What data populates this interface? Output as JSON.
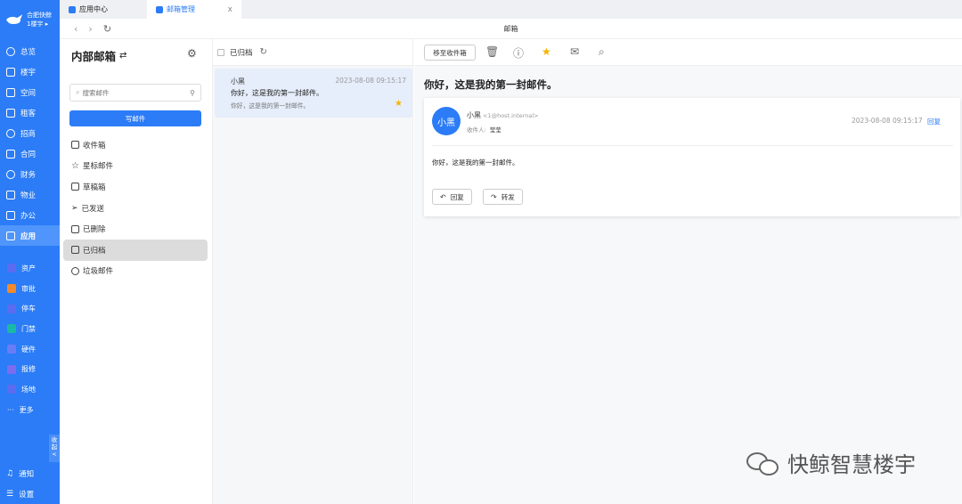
{
  "sidebar": {
    "org_line1": "合肥快鲸",
    "org_line2": "1楼宇",
    "nav": [
      {
        "label": "总览",
        "icon": "dashboard-icon"
      },
      {
        "label": "楼宇",
        "icon": "building-icon"
      },
      {
        "label": "空间",
        "icon": "space-icon"
      },
      {
        "label": "租客",
        "icon": "tenant-icon"
      },
      {
        "label": "招商",
        "icon": "investment-icon"
      },
      {
        "label": "合同",
        "icon": "contract-icon"
      },
      {
        "label": "财务",
        "icon": "finance-icon"
      },
      {
        "label": "物业",
        "icon": "property-icon"
      },
      {
        "label": "办公",
        "icon": "office-icon"
      },
      {
        "label": "应用",
        "icon": "apps-icon"
      }
    ],
    "apps": [
      {
        "label": "资产",
        "color": "#5b6cf0"
      },
      {
        "label": "审批",
        "color": "#f28a2b"
      },
      {
        "label": "停车",
        "color": "#5b6cf0"
      },
      {
        "label": "门禁",
        "color": "#19b9a6"
      },
      {
        "label": "硬件",
        "color": "#6a7cf5"
      },
      {
        "label": "报修",
        "color": "#7b6cf0"
      },
      {
        "label": "场地",
        "color": "#5b6cf0"
      }
    ],
    "more": "更多",
    "collapse": [
      "收",
      "起",
      "<"
    ],
    "notify": "通知",
    "settings": "设置"
  },
  "tabs": [
    {
      "label": "应用中心"
    },
    {
      "label": "邮箱管理",
      "close": "x"
    }
  ],
  "toolbar": {
    "title": "邮箱"
  },
  "mailbox": {
    "title": "内部邮箱",
    "search_placeholder": "搜索邮件",
    "compose": "写邮件",
    "folders": [
      "收件箱",
      "星标邮件",
      "草稿箱",
      "已发送",
      "已删除",
      "已归档",
      "垃圾邮件"
    ]
  },
  "list": {
    "header": "已归档",
    "item": {
      "sender": "小黑",
      "time": "2023-08-08 09:15:17",
      "subject": "你好，这是我的第一封邮件。",
      "preview": "你好，这是我的第一封邮件。"
    }
  },
  "reader": {
    "move_button": "移至收件箱",
    "subject": "你好，这是我的第一封邮件。",
    "avatar": "小黑",
    "from_name": "小黑",
    "from_addr": "<1@host.internal>",
    "to_label": "收件人:",
    "to_value": "莹莹",
    "time": "2023-08-08 09:15:17",
    "reply_link": "回复",
    "body": "你好，这是我的第一封邮件。",
    "reply_button": "回复",
    "forward_button": "转发"
  },
  "watermark": "快鲸智慧楼宇",
  "colors": {
    "accent": "#2b7cf6",
    "star": "#f5b400"
  }
}
